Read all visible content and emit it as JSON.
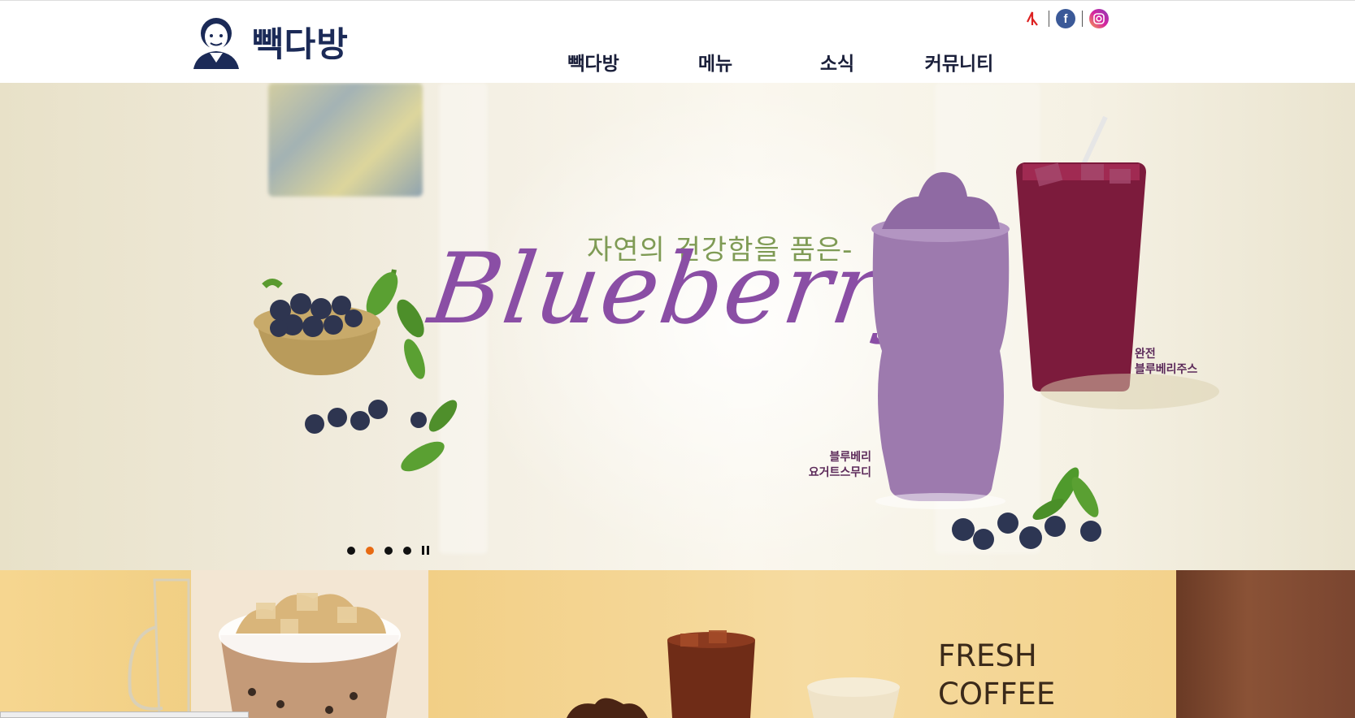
{
  "brand": {
    "name": "빽다방"
  },
  "social": [
    "logo-icon",
    "facebook-icon",
    "instagram-icon"
  ],
  "nav": [
    "빽다방",
    "메뉴",
    "소식",
    "커뮤니티"
  ],
  "hero": {
    "tagline": "자연의 건강함을 품은-",
    "script": "Blueberry",
    "product_right": [
      "완전",
      "블루베리주스"
    ],
    "product_left": [
      "블루베리",
      "요거트스무디"
    ],
    "slider": {
      "total": 4,
      "active": 2
    }
  },
  "promo": {
    "line1": "FRESH",
    "line2": "COFFEE"
  },
  "colors": {
    "brand": "#1b2a57",
    "accent": "#e76a12",
    "purple": "#8a4ea5",
    "green": "#7f9b55"
  }
}
